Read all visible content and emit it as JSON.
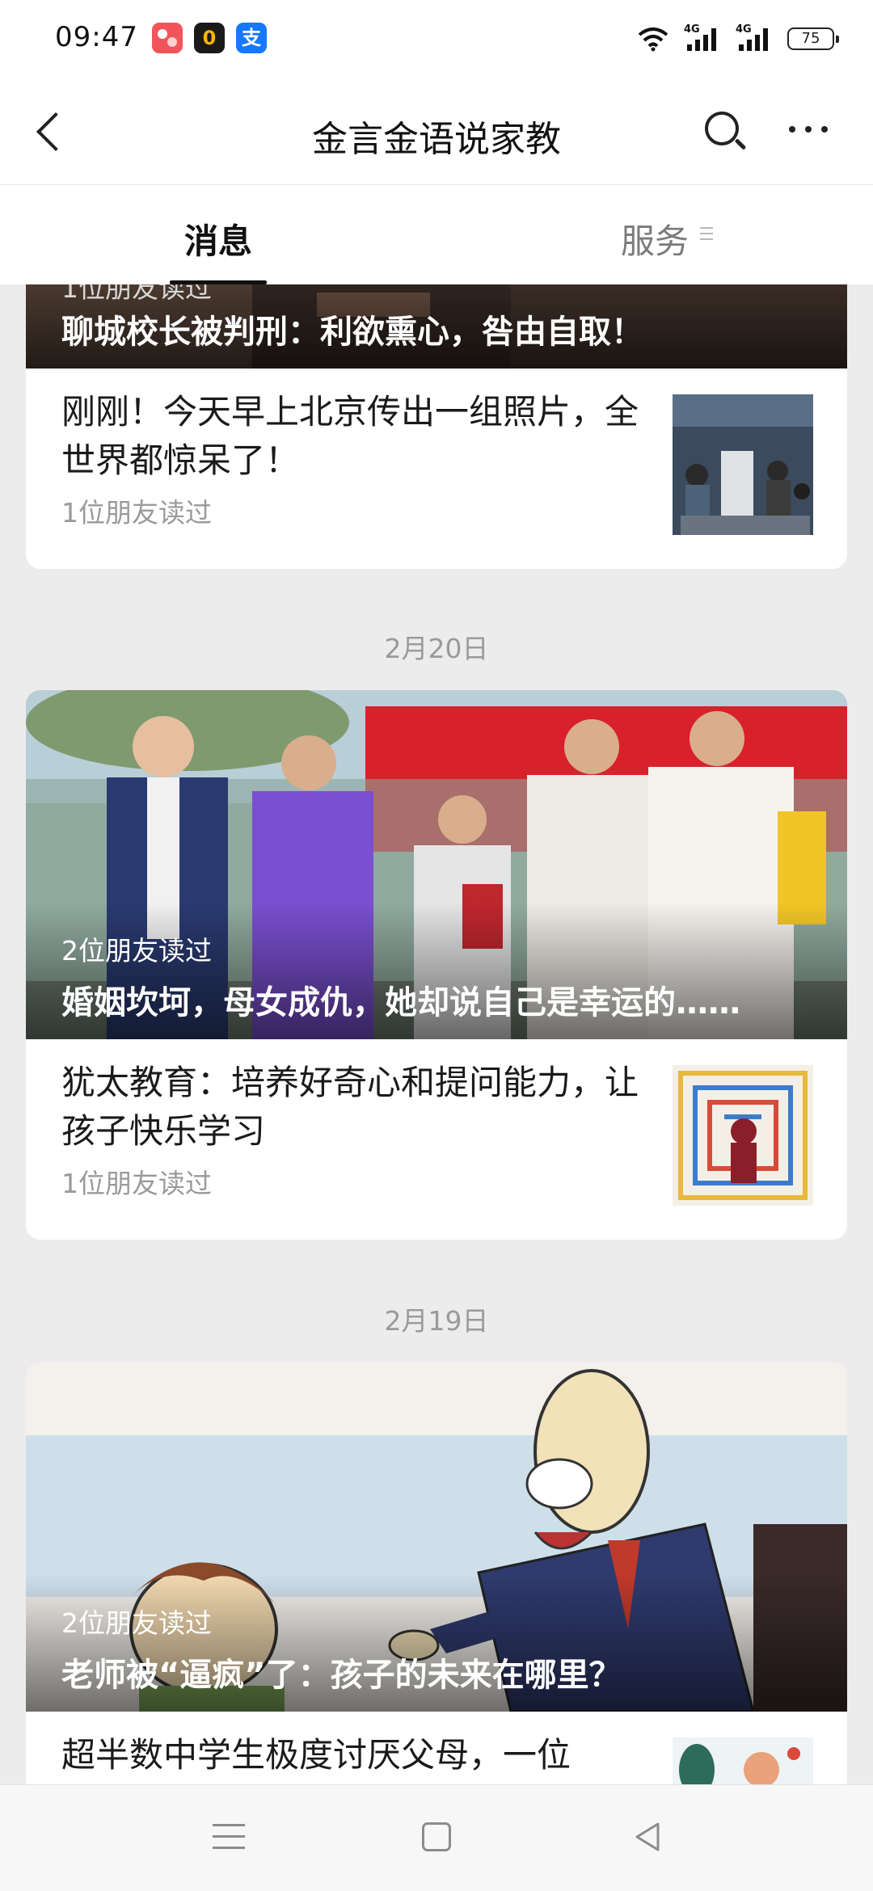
{
  "status_bar": {
    "time": "09:47",
    "apps": [
      {
        "icon": "app-icon-pink",
        "glyph": "",
        "color": "#f05a5a"
      },
      {
        "icon": "app-icon-black",
        "glyph": "0",
        "color": "#1a1a1a"
      },
      {
        "icon": "alipay-icon",
        "glyph": "支",
        "color": "#1677ff"
      }
    ],
    "signal1_label": "4G",
    "signal2_label": "4G",
    "battery": "75"
  },
  "header": {
    "title": "金言金语说家教"
  },
  "tabs": [
    {
      "label": "消息",
      "active": true
    },
    {
      "label": "服务",
      "active": false
    }
  ],
  "feed": {
    "group1": {
      "cover_title": "聊城校长被判刑：利欲熏心，咎由自取！",
      "cover_reads_partial": "1位朋友读过",
      "item": {
        "title": "刚刚！今天早上北京传出一组照片，全世界都惊呆了！",
        "reads": "1位朋友读过"
      }
    },
    "date2": "2月20日",
    "group2": {
      "cover_reads": "2位朋友读过",
      "cover_title": "婚姻坎坷，母女成仇，她却说自己是幸运的……",
      "item": {
        "title": "犹太教育：培养好奇心和提问能力，让孩子快乐学习",
        "reads": "1位朋友读过"
      }
    },
    "date3": "2月19日",
    "group3": {
      "cover_reads": "2位朋友读过",
      "cover_title": "老师被“逼疯”了：孩子的未来在哪里？",
      "item": {
        "title": "超半数中学生极度讨厌父母，一位"
      }
    }
  },
  "colors": {
    "background": "#ececec",
    "card": "#ffffff",
    "muted_text": "#9a9a9a",
    "banner_red": "#d8212a"
  }
}
